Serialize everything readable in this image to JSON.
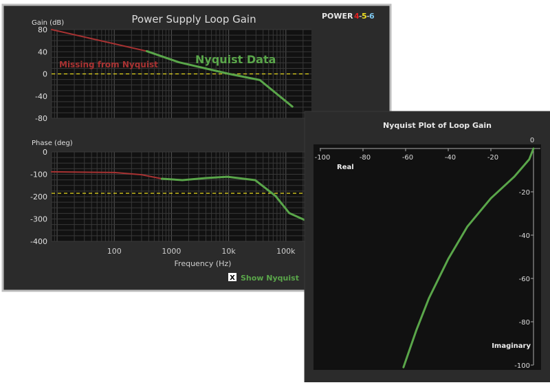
{
  "window": {
    "title": "Power Supply Loop Gain",
    "brand": {
      "word": "POWER",
      "d1": "4",
      "d2": "5",
      "d3": "6",
      "colors": {
        "d1": "#e02020",
        "d2": "#f0e020",
        "d3": "#7ec8f0"
      }
    },
    "show_nyquist": {
      "label": "Show Nyquist",
      "checked": true,
      "mark": "X"
    }
  },
  "colors": {
    "missing": "#a83232",
    "nyquist": "#5aa64a",
    "reference": "#e6d81e",
    "panel": "#2b2b2b",
    "plot": "#111111"
  },
  "chart_data": [
    {
      "type": "line",
      "title": "Power Supply Loop Gain",
      "ylabel": "Gain (dB)",
      "xscale": "log",
      "xlim": [
        8,
        280000
      ],
      "ylim": [
        -80,
        80
      ],
      "yticks": [
        "80",
        "40",
        "0",
        "-40",
        "-80"
      ],
      "ytick_values": [
        80,
        40,
        0,
        -40,
        -80
      ],
      "grid": true,
      "reference_line": 0,
      "annotations": {
        "missing": "Missing from Nyquist",
        "nyquist": "Nyquist Data"
      },
      "series": [
        {
          "role": "missing",
          "x": [
            8,
            370
          ],
          "y": [
            80,
            41
          ]
        },
        {
          "role": "nyquist",
          "x": [
            370,
            1350,
            10200,
            35000,
            130000
          ],
          "y": [
            41,
            21,
            0,
            -11,
            -59
          ]
        }
      ]
    },
    {
      "type": "line",
      "ylabel": "Phase (deg)",
      "xlabel": "Frequency (Hz)",
      "xscale": "log",
      "xlim": [
        8,
        280000
      ],
      "ylim": [
        -400,
        0
      ],
      "yticks": [
        "0",
        "-100",
        "-200",
        "-300",
        "-400"
      ],
      "ytick_values": [
        0,
        -100,
        -200,
        -300,
        -400
      ],
      "xticks": [
        "100",
        "1000",
        "10k",
        "100k"
      ],
      "xtick_values": [
        100,
        1000,
        10000,
        100000
      ],
      "grid": true,
      "reference_line": -185,
      "series": [
        {
          "role": "missing",
          "x": [
            8,
            100,
            300,
            680
          ],
          "y": [
            -89,
            -92,
            -102,
            -120
          ]
        },
        {
          "role": "nyquist",
          "x": [
            680,
            1550,
            4000,
            9500,
            29000,
            66000,
            115000,
            215000
          ],
          "y": [
            -120,
            -126,
            -117,
            -111,
            -126,
            -197,
            -274,
            -305
          ]
        }
      ]
    },
    {
      "type": "line",
      "title": "Nyquist Plot of Loop Gain",
      "xlabel": "Real",
      "ylabel": "Imaginary",
      "xlim": [
        -103,
        3
      ],
      "ylim": [
        -103,
        2
      ],
      "xticks": [
        "-100",
        "-80",
        "-60",
        "-40",
        "-20",
        "0"
      ],
      "xtick_values": [
        -100,
        -80,
        -60,
        -40,
        -20,
        0
      ],
      "yticks": [
        "-20",
        "-40",
        "-60",
        "-80",
        "-100"
      ],
      "ytick_values": [
        -20,
        -40,
        -60,
        -80,
        -100
      ],
      "series": [
        {
          "role": "nyquist",
          "x": [
            0,
            -2,
            -9,
            -20,
            -31,
            -40,
            -49,
            -55,
            -61
          ],
          "y": [
            0,
            -5,
            -13,
            -23,
            -36,
            -51,
            -69,
            -84,
            -101
          ]
        }
      ]
    }
  ]
}
